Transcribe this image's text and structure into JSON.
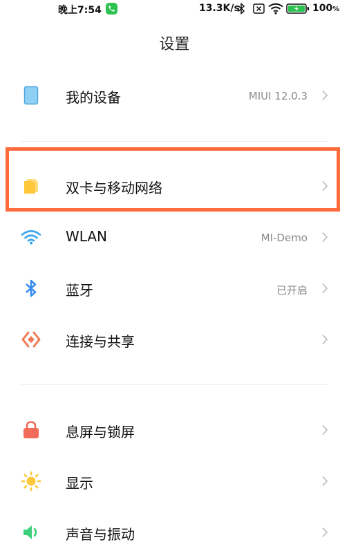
{
  "status_bar": {
    "time": "晚上7:54",
    "network_speed": "13.3K/s",
    "battery_percent": "100",
    "battery_unit": "%",
    "icons": [
      "phone-call-icon",
      "bluetooth-icon",
      "sim-icon",
      "wifi-icon",
      "battery-icon"
    ]
  },
  "header": {
    "title": "设置"
  },
  "colors": {
    "highlight": "#ff6b3d",
    "device_icon": "#8fd0f5",
    "sim_icon": "#ffc83a",
    "wifi_icon": "#3aa4ee",
    "bluetooth_icon": "#3a8ef0",
    "connect_icon": "#f07a55",
    "lock_icon": "#f26a5a",
    "display_icon": "#ffc83a",
    "sound_icon": "#3ccf7a"
  },
  "settings": {
    "device": {
      "label": "我的设备",
      "value": "MIUI 12.0.3",
      "icon": "device-icon"
    },
    "sim": {
      "label": "双卡与移动网络",
      "icon": "sim-card-icon"
    },
    "wlan": {
      "label": "WLAN",
      "value": "MI-Demo",
      "icon": "wifi-icon"
    },
    "bluetooth": {
      "label": "蓝牙",
      "value": "已开启",
      "icon": "bluetooth-icon"
    },
    "connection": {
      "label": "连接与共享",
      "icon": "connection-share-icon"
    },
    "lockscreen": {
      "label": "息屏与锁屏",
      "icon": "lock-icon"
    },
    "display": {
      "label": "显示",
      "icon": "brightness-icon"
    },
    "sound": {
      "label": "声音与振动",
      "icon": "speaker-icon"
    }
  }
}
